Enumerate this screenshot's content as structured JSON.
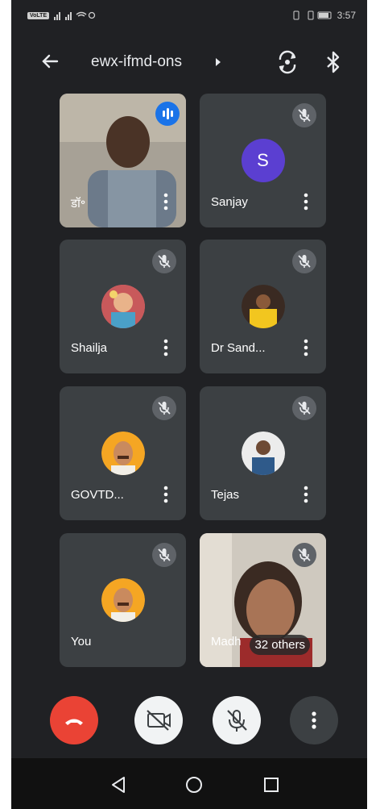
{
  "status_bar": {
    "left_chip": "VoLTE",
    "time": "3:57",
    "icons": [
      "sim-icon",
      "signal-icon",
      "signal-icon",
      "wifi-icon",
      "sync-icon",
      "vibrate-icon",
      "battery-icon"
    ]
  },
  "header": {
    "meeting_code": "ewx-ifmd-ons",
    "back_icon": "arrow-left-icon",
    "switch_camera_icon": "switch-camera-icon",
    "bluetooth_icon": "bluetooth-icon"
  },
  "participants": [
    {
      "name": "डॉ॰",
      "video": true,
      "speaking": true
    },
    {
      "name": "Sanjay",
      "avatar_letter": "S",
      "muted": true
    },
    {
      "name": "Shailja",
      "muted": true
    },
    {
      "name": "Dr Sand...",
      "muted": true
    },
    {
      "name": "GOVTD...",
      "muted": true
    },
    {
      "name": "Tejas",
      "muted": true
    },
    {
      "name": "You",
      "muted": true
    },
    {
      "name": "Madh",
      "video": true,
      "muted": true,
      "others_label": "32 others"
    }
  ],
  "controls": {
    "end_call": "end-call-icon",
    "camera_off": "camera-off-icon",
    "mic_off": "mic-off-icon",
    "more": "more-vert-icon"
  },
  "colors": {
    "background": "#202124",
    "tile": "#3c4043",
    "end_call": "#ea4335",
    "accent_blue": "#1a73e8",
    "avatar_purple": "#5b3fd1"
  }
}
